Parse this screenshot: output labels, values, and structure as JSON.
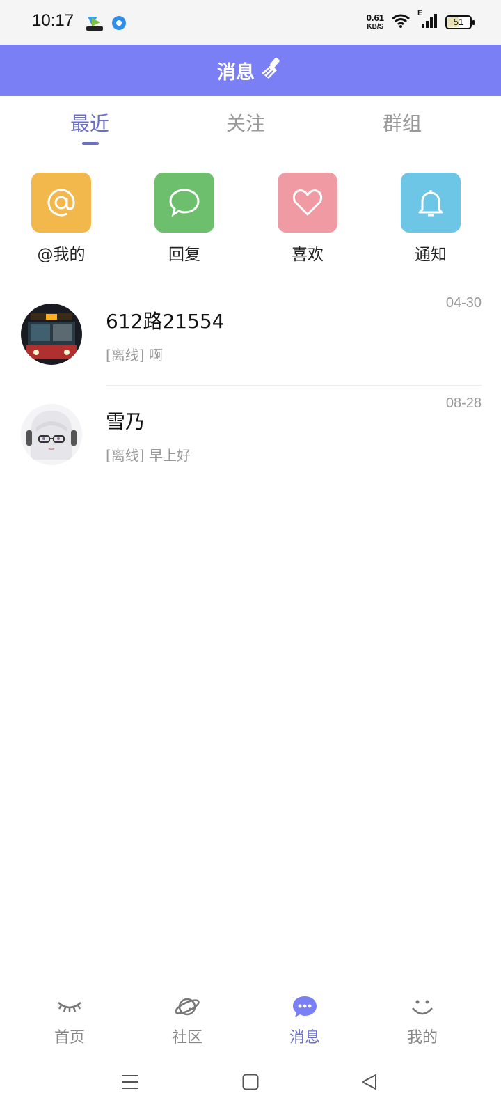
{
  "status_bar": {
    "time": "10:17",
    "net_speed_value": "0.61",
    "net_speed_unit": "KB/S",
    "signal_label": "E",
    "battery": "51",
    "battery_level": 0.51
  },
  "header": {
    "title": "消息",
    "action_icon": "broom-icon"
  },
  "tabs": [
    {
      "label": "最近",
      "active": true
    },
    {
      "label": "关注",
      "active": false
    },
    {
      "label": "群组",
      "active": false
    }
  ],
  "quick_actions": [
    {
      "label": "@我的",
      "icon": "at-icon",
      "color": "#f2b84b"
    },
    {
      "label": "回复",
      "icon": "chat-bubble-icon",
      "color": "#6dbf6e"
    },
    {
      "label": "喜欢",
      "icon": "heart-icon",
      "color": "#f09aa4"
    },
    {
      "label": "通知",
      "icon": "bell-icon",
      "color": "#6ec6e6"
    }
  ],
  "conversations": [
    {
      "name": "612路21554",
      "preview": "[离线] 啊",
      "time": "04-30"
    },
    {
      "name": "雪乃",
      "preview": "[离线] 早上好",
      "time": "08-28"
    }
  ],
  "bottom_nav": [
    {
      "label": "首页",
      "icon": "eye-closed-icon",
      "active": false
    },
    {
      "label": "社区",
      "icon": "planet-icon",
      "active": false
    },
    {
      "label": "消息",
      "icon": "message-bubble-icon",
      "active": true
    },
    {
      "label": "我的",
      "icon": "smile-icon",
      "active": false
    }
  ],
  "colors": {
    "accent": "#7b7ff5",
    "tab_active": "#6a6fc4",
    "inactive": "#888888"
  }
}
